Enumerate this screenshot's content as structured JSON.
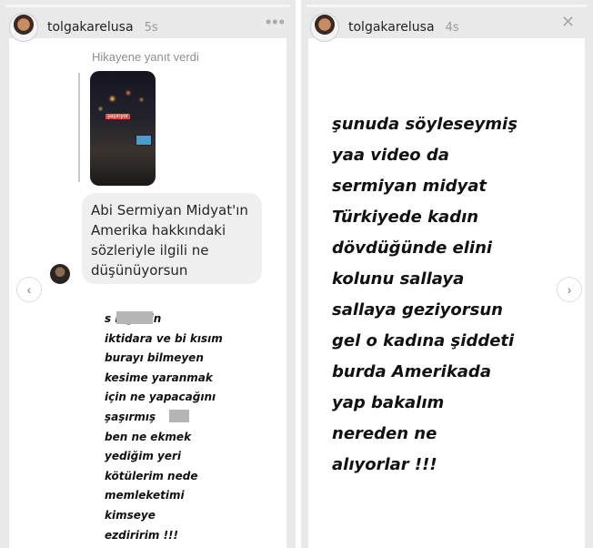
{
  "left_story": {
    "username": "tolgakarelusa",
    "timestamp": "5s",
    "reply_label": "Hikayene yanıt verdi",
    "thumbnail_caption": "şaşırıyor",
    "message": "Abi Sermiyan Midyat'ın Amerika hakkındaki sözleriyle ilgili ne düşünüyorsun",
    "story_text": "s       n gitsin\niktidara ve bi kısım\nburayı bilmeyen\nkesime yaranmak\niçin  ne yapacağını\nşaşırmış\nben ne ekmek\nyediğim yeri\nkötülerim nede\nmemleketimi\nkimseye\nezdiririm !!!",
    "nav_prev": "‹"
  },
  "right_story": {
    "username": "tolgakarelusa",
    "timestamp": "4s",
    "story_text": "şunuda söyleseymiş\nyaa video da\nsermiyan midyat\nTürkiyede kadın\ndövdüğünde elini\nkolunu sallaya\nsallaya geziyorsun\ngel o kadına şiddeti\nburda Amerikada\nyap bakalım\nnereden ne\nalıyorlar !!!",
    "nav_next": "›"
  },
  "icons": {
    "more": "more-horizontal-icon",
    "close": "close-icon",
    "prev": "chevron-left-icon",
    "next": "chevron-right-icon"
  },
  "close_glyph": "✕",
  "more_glyph": "•••"
}
